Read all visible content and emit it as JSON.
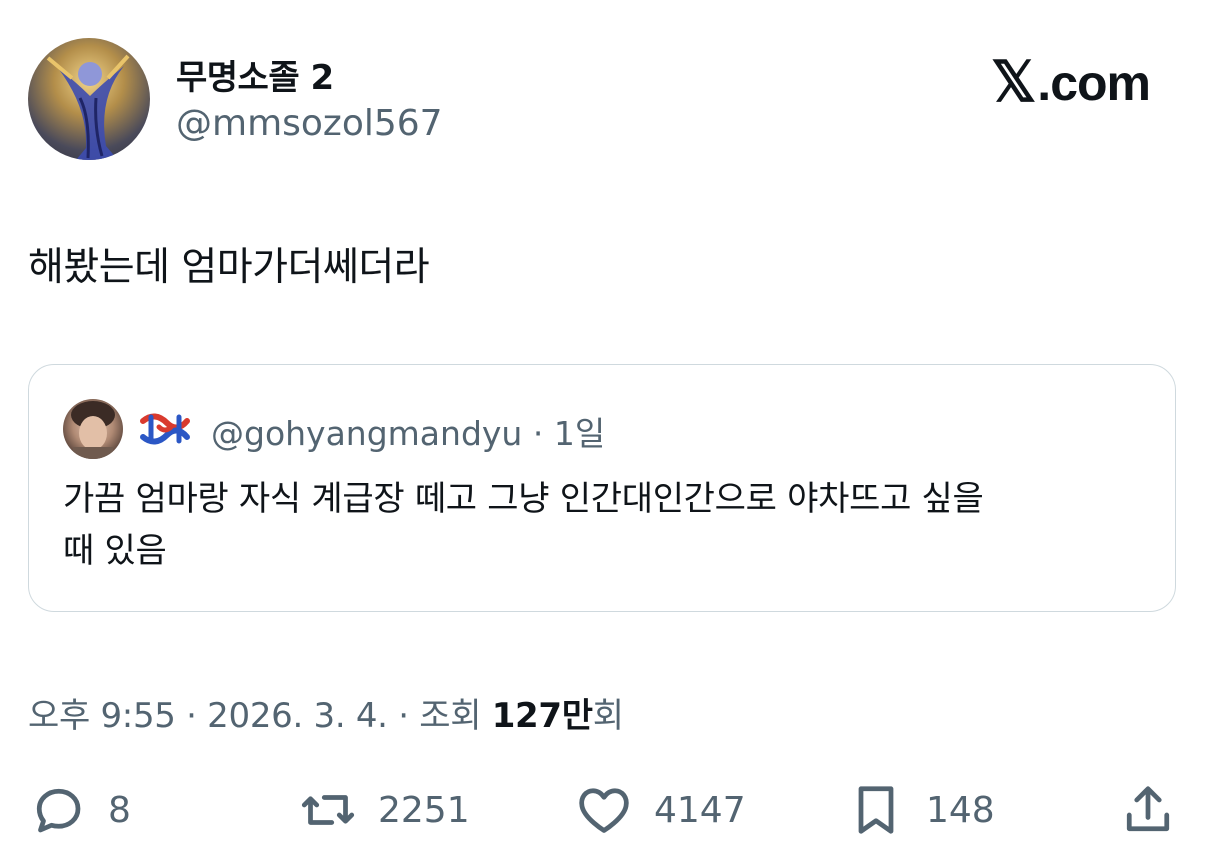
{
  "author": {
    "display_name": "무명소졸 2",
    "handle": "@mmsozol567",
    "avatar_icon": "avatar-image"
  },
  "brand": {
    "mark": "𝕏",
    "suffix": ".com"
  },
  "tweet": {
    "text": "해봤는데 엄마가더쎄더라"
  },
  "quote": {
    "handle": "@gohyangmandyu",
    "separator": "·",
    "time": "1일",
    "text_line1": "가끔 엄마랑 자식 계급장 떼고 그냥 인간대인간으로 야차뜨고 싶을",
    "text_line2": "때 있음",
    "badge_colors": [
      "#2b57c5",
      "#d93a2e"
    ]
  },
  "meta": {
    "time": "오후 9:55",
    "sep1": " · ",
    "date": "2026. 3. 4.",
    "sep2": " · ",
    "views_label": "조회 ",
    "views_value": "127만",
    "views_suffix": "회"
  },
  "actions": {
    "reply": {
      "icon": "reply-icon",
      "count": "8"
    },
    "retweet": {
      "icon": "retweet-icon",
      "count": "2251"
    },
    "like": {
      "icon": "heart-icon",
      "count": "4147"
    },
    "bookmark": {
      "icon": "bookmark-icon",
      "count": "148"
    },
    "share": {
      "icon": "share-icon"
    }
  },
  "colors": {
    "text": "#0f1419",
    "secondary": "#536471",
    "border": "#cfd9de"
  }
}
